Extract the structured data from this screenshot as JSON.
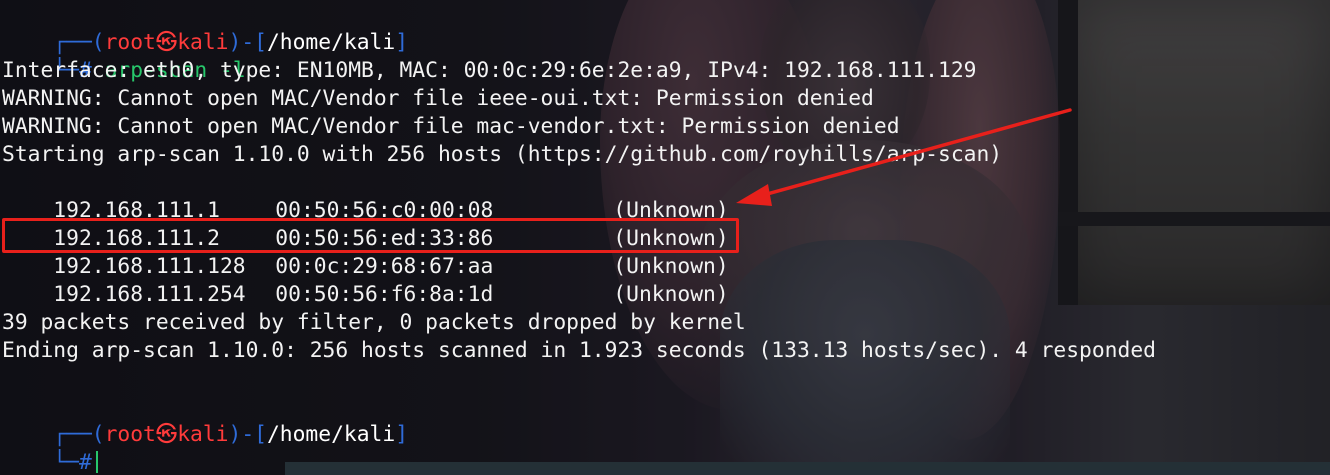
{
  "prompt_top": {
    "open": "┌──(",
    "user": "root",
    "at": "㉿",
    "host": "kali",
    "sep": ")-[",
    "path": "/home/kali",
    "close": "]",
    "corner": "└─",
    "hash": "#",
    "command": "arp-scan -l"
  },
  "output": [
    "Interface: eth0, type: EN10MB, MAC: 00:0c:29:6e:2e:a9, IPv4: 192.168.111.129",
    "WARNING: Cannot open MAC/Vendor file ieee-oui.txt: Permission denied",
    "WARNING: Cannot open MAC/Vendor file mac-vendor.txt: Permission denied",
    "Starting arp-scan 1.10.0 with 256 hosts (https://github.com/royhills/arp-scan)"
  ],
  "hosts": [
    {
      "ip": "192.168.111.1",
      "mac": "00:50:56:c0:00:08",
      "vendor": "(Unknown)"
    },
    {
      "ip": "192.168.111.2",
      "mac": "00:50:56:ed:33:86",
      "vendor": "(Unknown)"
    },
    {
      "ip": "192.168.111.128",
      "mac": "00:0c:29:68:67:aa",
      "vendor": "(Unknown)"
    },
    {
      "ip": "192.168.111.254",
      "mac": "00:50:56:f6:8a:1d",
      "vendor": "(Unknown)"
    }
  ],
  "summary": [
    "39 packets received by filter, 0 packets dropped by kernel",
    "Ending arp-scan 1.10.0: 256 hosts scanned in 1.923 seconds (133.13 hosts/sec). 4 responded"
  ],
  "prompt_bottom": {
    "open": "┌──(",
    "user": "root",
    "at": "㉿",
    "host": "kali",
    "sep": ")-[",
    "path": "/home/kali",
    "close": "]",
    "corner": "└─",
    "hash": "#",
    "command": ""
  },
  "colors": {
    "frame": "#2f6bd8",
    "user": "#ff3b3b",
    "command": "#27c76b",
    "text": "#f3f3f3",
    "annotation": "#e8201b"
  }
}
